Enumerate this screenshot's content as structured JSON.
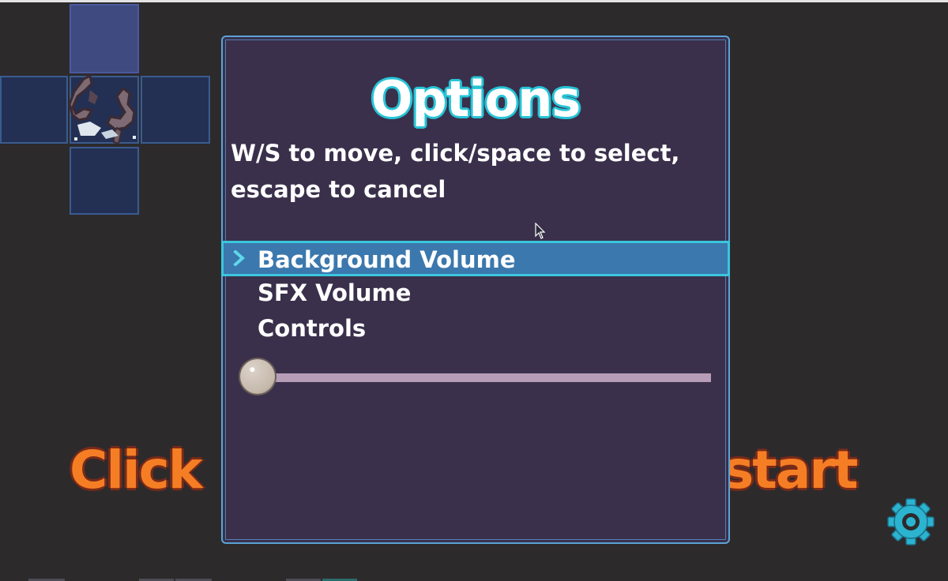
{
  "banner": {
    "left_text": "Click",
    "right_text": "start"
  },
  "options": {
    "title": "Options",
    "instructions_line1": "W/S to move, click/space to select,",
    "instructions_line2": "escape to cancel",
    "menu": [
      {
        "label": "Background Volume",
        "selected": true
      },
      {
        "label": "SFX Volume",
        "selected": false
      },
      {
        "label": "Controls",
        "selected": false
      }
    ],
    "volume_level": 0.0
  },
  "colors": {
    "background": "#2d2a2c",
    "panel": "#3a304b",
    "panel_border": "#5aa3d6",
    "title_outline": "#27c4d6",
    "selection": "#3b78ad",
    "banner": "#f57e25",
    "gear": "#2bb3cf"
  },
  "icons": {
    "selection": "chevron-right-icon",
    "settings": "gear-icon",
    "pointer": "mouse-cursor-icon"
  }
}
